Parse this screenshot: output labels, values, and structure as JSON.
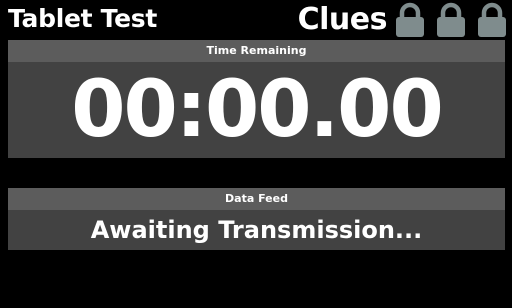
{
  "app": {
    "title": "Tablet Test"
  },
  "clues": {
    "label": "Clues",
    "locks": [
      {
        "icon": "lock-icon",
        "state": "locked"
      },
      {
        "icon": "lock-icon",
        "state": "locked"
      },
      {
        "icon": "lock-icon",
        "state": "locked"
      }
    ]
  },
  "timer": {
    "header": "Time Remaining",
    "value": "00:00.00"
  },
  "feed": {
    "header": "Data Feed",
    "value": "Awaiting Transmission..."
  },
  "colors": {
    "background": "#000000",
    "panel_body": "#424242",
    "panel_header": "#5c5c5c",
    "lock": "#7f8c8d",
    "text": "#ffffff"
  }
}
